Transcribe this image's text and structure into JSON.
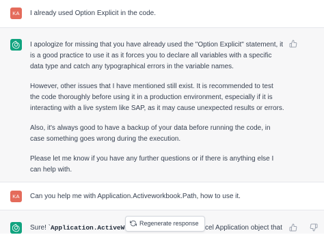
{
  "conversation": {
    "user_initials": "KA",
    "messages": [
      {
        "role": "user",
        "text": "I already used Option Explicit in the code."
      },
      {
        "role": "assistant",
        "paragraphs": [
          "I apologize for missing that you have already used the \"Option Explicit\" statement, it is a good practice to use it as it forces you to declare all variables with a specific data type and catch any typographical errors in the variable names.",
          "However, other issues that I have mentioned still exist. It is recommended to test the code thoroughly before using it in a production environment, especially if it is interacting with a live system like SAP, as it may cause unexpected results or errors.",
          "Also, it's always good to have a backup of your data before running the code, in case something goes wrong during the execution.",
          "Please let me know if you have any further questions or if there is anything else I can help with."
        ]
      },
      {
        "role": "user",
        "text": "Can you help me with Application.Activeworkbook.Path, how to use it."
      },
      {
        "role": "assistant",
        "partial_prefix": "Sure! `",
        "partial_code": "Application.ActiveWorkbook",
        "partial_suffix": "e Excel Application object that"
      }
    ]
  },
  "controls": {
    "regenerate_label": "Regenerate response"
  },
  "icons": {
    "thumbs_up": "thumbs-up-icon",
    "thumbs_down": "thumbs-down-icon",
    "assistant_logo": "openai-logo-icon",
    "regenerate": "refresh-icon"
  },
  "colors": {
    "user_avatar": "#e46b5b",
    "assistant_avatar": "#10a37f",
    "assistant_bg": "#f7f7f8"
  }
}
